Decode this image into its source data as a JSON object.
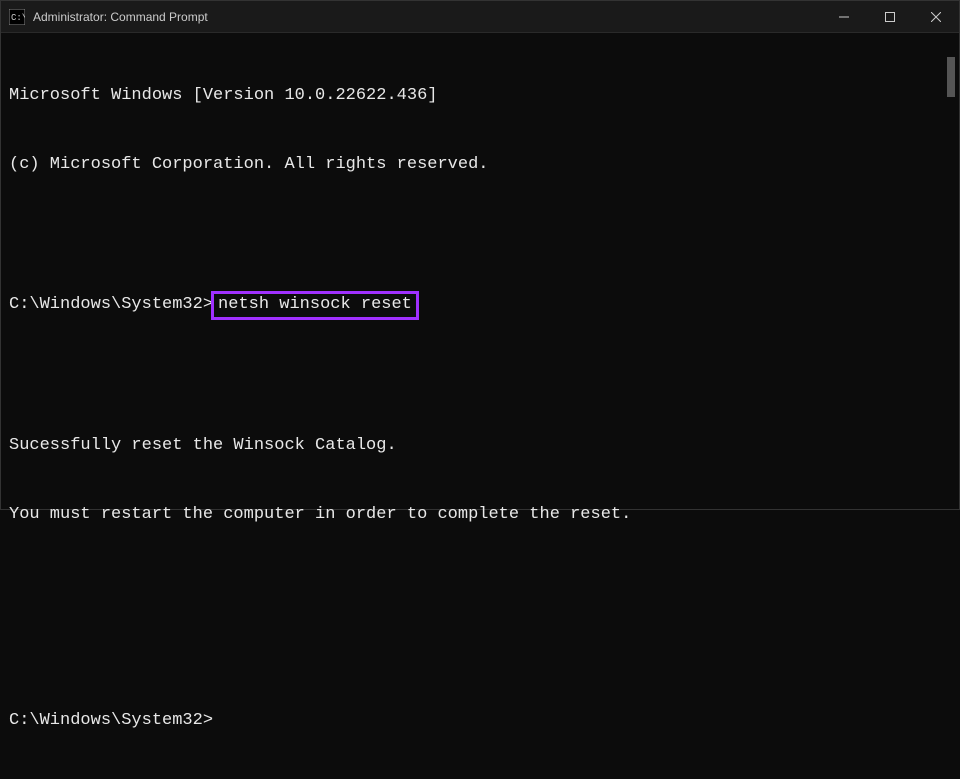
{
  "window": {
    "title": "Administrator: Command Prompt"
  },
  "terminal": {
    "line1": "Microsoft Windows [Version 10.0.22622.436]",
    "line2": "(c) Microsoft Corporation. All rights reserved.",
    "prompt1_path": "C:\\Windows\\System32>",
    "prompt1_command": "netsh winsock reset",
    "output_line1": "Sucessfully reset the Winsock Catalog.",
    "output_line2": "You must restart the computer in order to complete the reset.",
    "prompt2_path": "C:\\Windows\\System32>"
  }
}
